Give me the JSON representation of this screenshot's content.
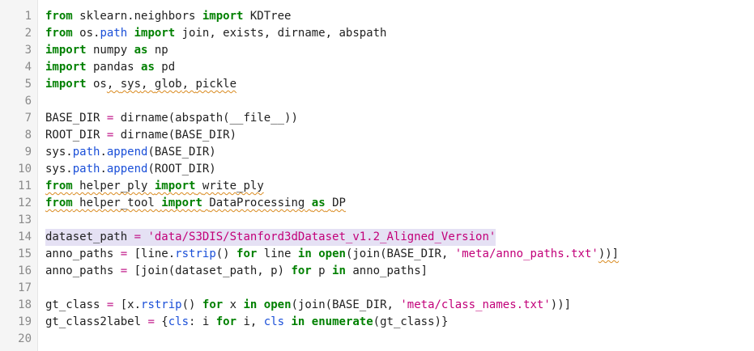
{
  "editor": {
    "lines": [
      {
        "num": "1"
      },
      {
        "num": "2"
      },
      {
        "num": "3"
      },
      {
        "num": "4"
      },
      {
        "num": "5"
      },
      {
        "num": "6"
      },
      {
        "num": "7"
      },
      {
        "num": "8"
      },
      {
        "num": "9"
      },
      {
        "num": "10"
      },
      {
        "num": "11"
      },
      {
        "num": "12"
      },
      {
        "num": "13"
      },
      {
        "num": "14"
      },
      {
        "num": "15"
      },
      {
        "num": "16"
      },
      {
        "num": "17"
      },
      {
        "num": "18"
      },
      {
        "num": "19"
      },
      {
        "num": "20"
      }
    ],
    "tokens": {
      "l1": [
        "from",
        " sklearn.neighbors ",
        "import",
        " KDTree"
      ],
      "l2": [
        "from",
        " os.",
        "path",
        " ",
        "import",
        " join, exists, dirname, abspath"
      ],
      "l3": [
        "import",
        " numpy ",
        "as",
        " np"
      ],
      "l4": [
        "import",
        " pandas ",
        "as",
        " pd"
      ],
      "l5": [
        "import",
        " os",
        ", ",
        "sys",
        ", ",
        "glob",
        ", ",
        "pickle"
      ],
      "l7": [
        "BASE_DIR ",
        "=",
        " dirname(abspath(__file__))"
      ],
      "l8": [
        "ROOT_DIR ",
        "=",
        " dirname(BASE_DIR)"
      ],
      "l9": [
        "sys.",
        "path",
        ".",
        "append",
        "(BASE_DIR)"
      ],
      "l10": [
        "sys.",
        "path",
        ".",
        "append",
        "(ROOT_DIR)"
      ],
      "l11": [
        "from",
        " helper_ply ",
        "import",
        " ",
        "write_ply"
      ],
      "l12": [
        "from",
        " helper_tool ",
        "import",
        " ",
        "DataProcessing",
        " ",
        "as",
        " ",
        "DP"
      ],
      "l14": [
        "dataset_path ",
        "=",
        " ",
        "'data/S3DIS/Stanford3dDataset_v1.2_Aligned_Version'"
      ],
      "l15": [
        "anno_paths ",
        "=",
        " [line.",
        "rstrip",
        "() ",
        "for",
        " line ",
        "in",
        " ",
        "open",
        "(join(BASE_DIR, ",
        "'meta/anno_paths.txt'",
        "))]"
      ],
      "l16": [
        "anno_paths ",
        "=",
        " [join(dataset_path, p) ",
        "for",
        " p ",
        "in",
        " anno_paths]"
      ],
      "l18": [
        "gt_class ",
        "=",
        " [x.",
        "rstrip",
        "() ",
        "for",
        " x ",
        "in",
        " ",
        "open",
        "(join(BASE_DIR, ",
        "'meta/class_names.txt'",
        "))]"
      ],
      "l19": [
        "gt_class2label ",
        "=",
        " {",
        "cls",
        ": i ",
        "for",
        " i, ",
        "cls",
        " ",
        "in",
        " ",
        "enumerate",
        "(gt_class)}"
      ]
    }
  },
  "colors": {
    "keyword": "#008000",
    "string": "#c20079",
    "attribute": "#1a4fd8",
    "operator": "#c21c8b",
    "line_number": "#8a8a8a",
    "highlight": "#e5e1f4",
    "squiggle": "#d98a1f"
  }
}
